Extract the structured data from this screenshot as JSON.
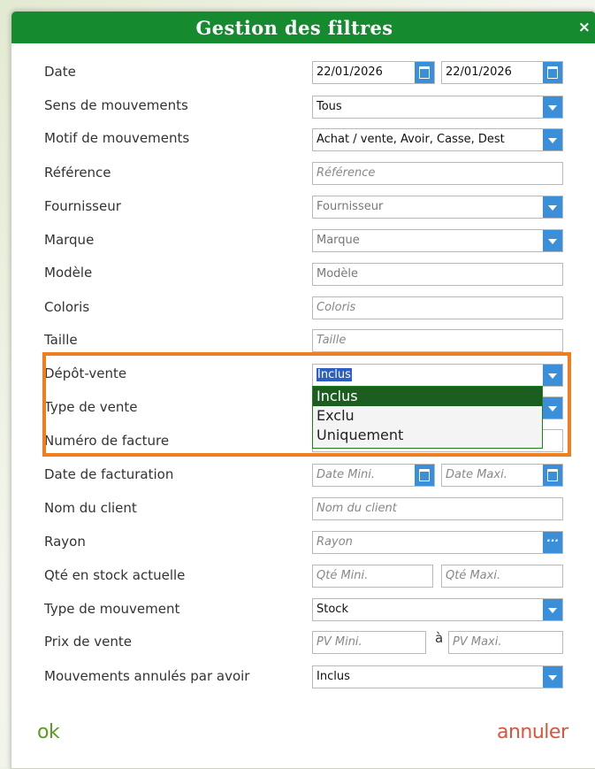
{
  "dialog": {
    "title": "Gestion des filtres",
    "close_label": "×"
  },
  "filters": {
    "date": {
      "label": "Date",
      "from": "22/01/2026",
      "to": "22/01/2026"
    },
    "sens": {
      "label": "Sens de mouvements",
      "value": "Tous"
    },
    "motif": {
      "label": "Motif de mouvements",
      "value": "Achat / vente, Avoir, Casse, Dest"
    },
    "reference": {
      "label": "Référence",
      "placeholder": "Référence"
    },
    "fournisseur": {
      "label": "Fournisseur",
      "value": "Fournisseur"
    },
    "marque": {
      "label": "Marque",
      "value": "Marque"
    },
    "modele": {
      "label": "Modèle",
      "value": "Modèle"
    },
    "coloris": {
      "label": "Coloris",
      "placeholder": "Coloris"
    },
    "taille": {
      "label": "Taille",
      "placeholder": "Taille"
    },
    "depot_vente": {
      "label": "Dépôt-vente",
      "value": "Inclus",
      "options": [
        "Inclus",
        "Exclu",
        "Uniquement"
      ],
      "selected_index": 0
    },
    "type_vente": {
      "label": "Type de vente"
    },
    "numero_facture": {
      "label": "Numéro de facture"
    },
    "date_facturation": {
      "label": "Date de facturation",
      "min_placeholder": "Date Mini.",
      "max_placeholder": "Date Maxi."
    },
    "nom_client": {
      "label": "Nom du client",
      "placeholder": "Nom du client"
    },
    "rayon": {
      "label": "Rayon",
      "placeholder": "Rayon",
      "button": "···"
    },
    "qte_stock": {
      "label": "Qté en stock actuelle",
      "min_placeholder": "Qté Mini.",
      "max_placeholder": "Qté Maxi."
    },
    "type_mouvement": {
      "label": "Type de mouvement",
      "value": "Stock"
    },
    "prix_vente": {
      "label": "Prix de vente",
      "min_placeholder": "PV Mini.",
      "separator": "à",
      "max_placeholder": "PV Maxi."
    },
    "annules_avoir": {
      "label": "Mouvements annulés par avoir",
      "value": "Inclus"
    }
  },
  "actions": {
    "ok_label": "ok",
    "cancel_label": "annuler"
  },
  "colors": {
    "title_bar": "#168a2f",
    "accent_blue": "#3b8fd9",
    "highlight": "#f07d1e",
    "ok": "#5a9e1c",
    "cancel": "#e0533a"
  }
}
